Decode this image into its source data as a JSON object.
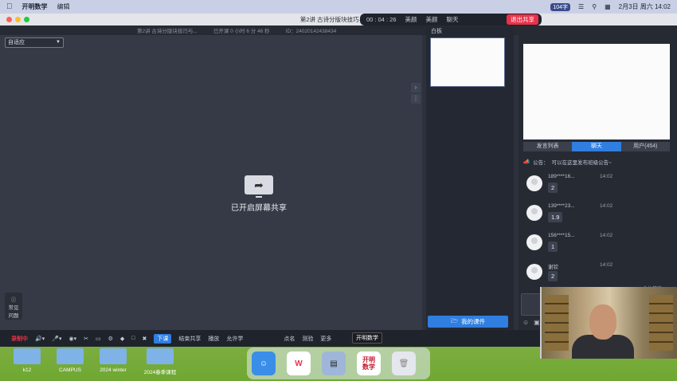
{
  "menubar": {
    "app_name": "开明数学",
    "edit_menu": "编辑",
    "wechat_pill": "104字",
    "date_time": "2月3日 周六 14:02"
  },
  "window": {
    "title": "第2讲 古诗分版块技巧与基础",
    "subtitle": "第2讲 古诗分版块技巧与...",
    "status": "已开课 0 小时 6 分 46 秒",
    "id": "ID：24020142438434"
  },
  "classbar": {
    "timer": "00 : 04 : 26",
    "beauty": "美颜",
    "camera": "美颜",
    "chat": "聊天",
    "exit": "退出共享"
  },
  "stage": {
    "fit_select": "自适应",
    "share_label": "已开启屏幕共享",
    "faq_label_1": "常见",
    "faq_label_2": "问题"
  },
  "whiteboard": {
    "title": "白板",
    "mycourse": "我的课件"
  },
  "right_panel": {
    "tabs": [
      "发言列表",
      "聊天",
      "用户(454)"
    ],
    "active_tab": 1,
    "notice_label": "公告：",
    "notice_text": "可以在这里发布班级公告~",
    "messages": [
      {
        "name": "189****16...",
        "time": "14:02",
        "text": "2"
      },
      {
        "name": "139****23...",
        "time": "14:02",
        "text": "1.9"
      },
      {
        "name": "156****15...",
        "time": "14:02",
        "text": "1"
      },
      {
        "name": "谢钦",
        "time": "14:02",
        "text": "2"
      }
    ],
    "all_mute": "全体禁言",
    "ask_label": "问"
  },
  "toolbar": {
    "record": "录制中",
    "next_class": "下课",
    "end_share": "结束共享",
    "play": "播放",
    "allow": "允许学",
    "roll_call": "点名",
    "quiz": "测验",
    "more": "更多"
  },
  "tooltip": "开明数学",
  "desktop": {
    "folders": [
      "k12",
      "CAMPUS",
      "2024 winter",
      "2024春季课程"
    ]
  },
  "dock": {
    "kaiming_label_1": "开明",
    "kaiming_label_2": "数学"
  },
  "colors": {
    "accent": "#2f7ee0",
    "exit_red": "#e8324a"
  }
}
